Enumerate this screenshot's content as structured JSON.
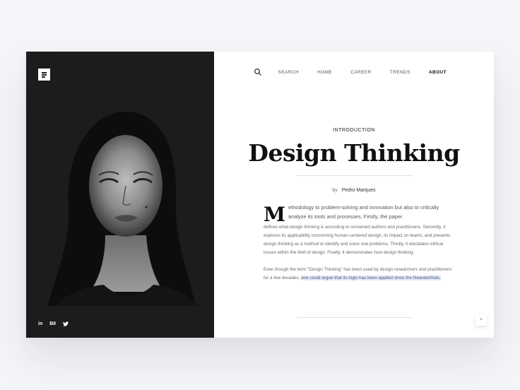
{
  "nav": {
    "items": [
      "SEARCH",
      "HOME",
      "CAREER",
      "TRENDS",
      "ABOUT"
    ],
    "active": "ABOUT"
  },
  "social": [
    "in",
    "Bē",
    "twitter-icon"
  ],
  "article": {
    "section": "INTRODUCTION",
    "title": "Design Thinking",
    "byline_prefix": "by",
    "author": "Pedro Marques",
    "dropcap": "M",
    "lead": "ethodology to problem-solving and innovation but also to critically analyze its tools and processes. Firstly, the paper",
    "body1": "defines what design thinking is according to renowned authors and practitioners. Secondly, it explores its applicability concerning human-centered design, its impact on teams, and presents design thinking as a method to identify and solve real problems. Thirdly, it elucidates ethical issues within the field of design. Finally, it demonstrates how design thinking.",
    "body2_plain": "Even though the term \"Design Thinking\" has been used by design researchers and practitioners for a few decades, ",
    "body2_highlight": "one could argue that its logic has been applied since the Neanderthals."
  },
  "scroll_top_label": "˄",
  "colors": {
    "dark_panel": "#1c1c1c",
    "highlight_bg": "#e6ebf7",
    "highlight_text": "#4f5a86",
    "page_bg": "#f4f5f8"
  }
}
